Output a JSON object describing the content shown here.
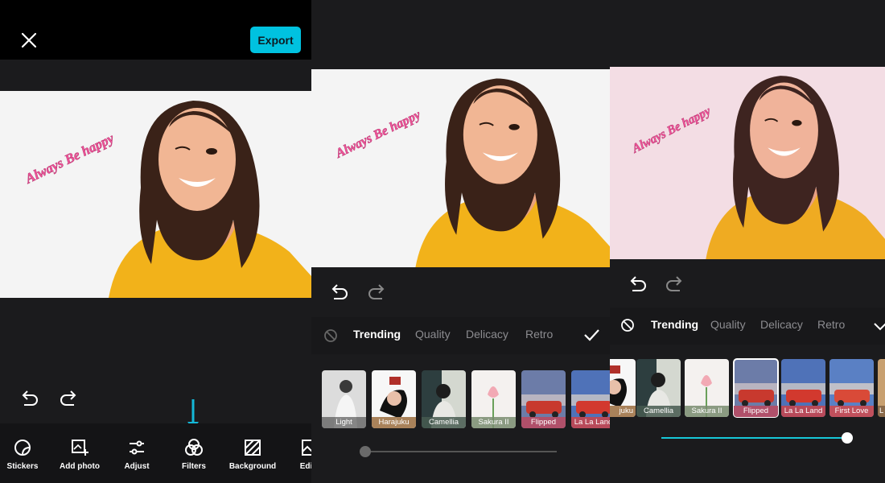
{
  "app": {
    "export_label": "Export"
  },
  "photo": {
    "caption": "Always Be happy",
    "accent_pink": "#f0559a"
  },
  "toolbar": {
    "items": [
      {
        "label": "Stickers",
        "icon": "sticker-icon"
      },
      {
        "label": "Add photo",
        "icon": "add-photo-icon"
      },
      {
        "label": "Adjust",
        "icon": "sliders-icon"
      },
      {
        "label": "Filters",
        "icon": "filters-icon"
      },
      {
        "label": "Background",
        "icon": "background-icon"
      },
      {
        "label": "Edit i",
        "icon": "image-icon"
      }
    ]
  },
  "filters": {
    "tabs": [
      "Trending",
      "Quality",
      "Delicacy",
      "Retro"
    ],
    "active_tab": "Trending",
    "panel2_thumbs": [
      "Light",
      "Harajuku",
      "Camellia",
      "Sakura II",
      "Flipped",
      "La La Land"
    ],
    "panel3_thumbs": [
      "juku",
      "Camellia",
      "Sakura II",
      "Flipped",
      "La La Land",
      "First Love",
      "L"
    ],
    "panel3_selected": "Flipped",
    "panel2_intensity": 0,
    "panel3_intensity": 1.0,
    "accent": "#17c7d8"
  }
}
